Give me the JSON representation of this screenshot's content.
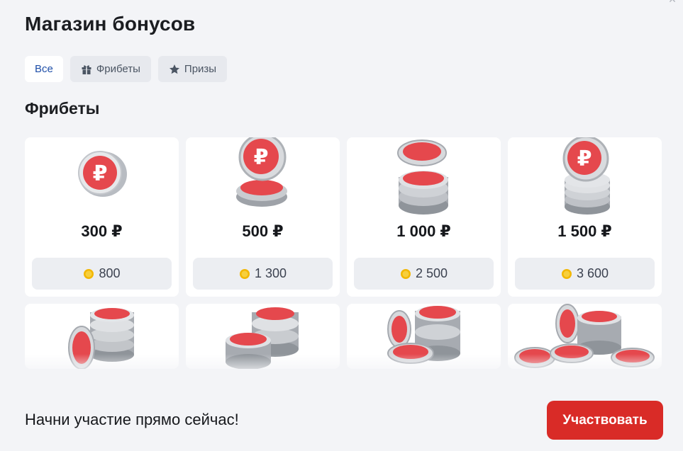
{
  "header": {
    "title": "Магазин бонусов",
    "close_icon": "close-icon"
  },
  "tabs": [
    {
      "label": "Все",
      "active": true,
      "icon": null
    },
    {
      "label": "Фрибеты",
      "active": false,
      "icon": "gift-icon"
    },
    {
      "label": "Призы",
      "active": false,
      "icon": "star-icon"
    }
  ],
  "section": {
    "title": "Фрибеты"
  },
  "cards": [
    {
      "amount": "300 ₽",
      "price": "800",
      "icon": "ruble-coin-single-icon"
    },
    {
      "amount": "500 ₽",
      "price": "1 300",
      "icon": "ruble-coin-stack-small-icon"
    },
    {
      "amount": "1 000 ₽",
      "price": "2 500",
      "icon": "ruble-coin-stack-medium-icon"
    },
    {
      "amount": "1 500 ₽",
      "price": "3 600",
      "icon": "ruble-coin-stack-large-icon"
    }
  ],
  "cards_partial": [
    {
      "icon": "ruble-coin-pile-icon"
    },
    {
      "icon": "ruble-coin-pile-icon"
    },
    {
      "icon": "ruble-coin-pile-icon"
    },
    {
      "icon": "ruble-coin-pile-icon"
    }
  ],
  "footer": {
    "text": "Начни участие прямо сейчас!",
    "button_label": "Участвовать"
  },
  "colors": {
    "accent": "#d92b27",
    "tab_active_text": "#1f4fa8",
    "coin_red": "#e5484d",
    "gold": "#f2b705"
  }
}
